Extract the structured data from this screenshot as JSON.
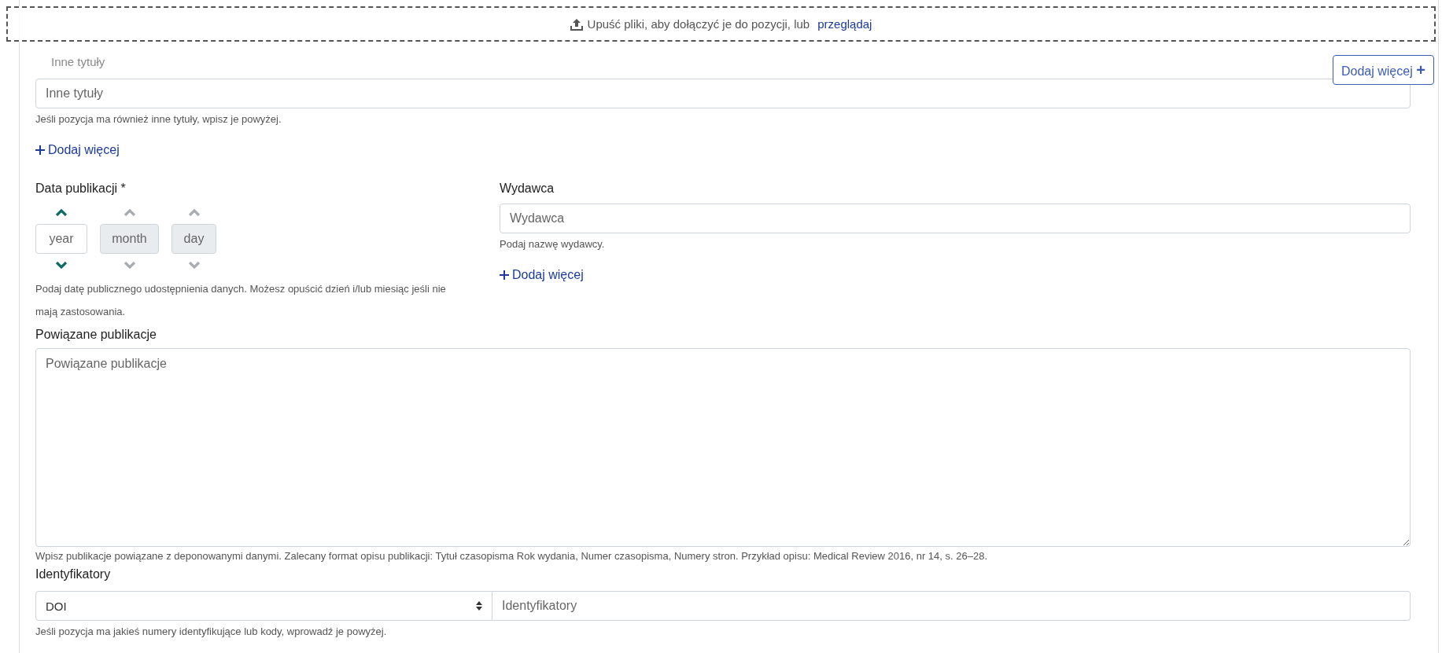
{
  "dropzone": {
    "text": "Upuść pliki, aby dołączyć je do pozycji, lub",
    "link": "przeglądaj"
  },
  "add_more_button": {
    "label": "Dodaj więcej",
    "icon": "+"
  },
  "other_titles": {
    "label": "Inne tytuły",
    "placeholder": "Inne tytuły",
    "help": "Jeśli pozycja ma również inne tytuły, wpisz je powyżej.",
    "add_link": "Dodaj więcej"
  },
  "publication_date": {
    "label": "Data publikacji *",
    "parts": [
      {
        "placeholder": "year",
        "disabled": false
      },
      {
        "placeholder": "month",
        "disabled": true
      },
      {
        "placeholder": "day",
        "disabled": true
      }
    ],
    "help": "Podaj datę publicznego udostępnienia danych. Możesz opuścić dzień i/lub miesiąc jeśli nie mają zastosowania."
  },
  "publisher": {
    "label": "Wydawca",
    "placeholder": "Wydawca",
    "help": "Podaj nazwę wydawcy.",
    "add_link": "Dodaj więcej"
  },
  "related_publications": {
    "label": "Powiązane publikacje",
    "placeholder": "Powiązane publikacje",
    "help": "Wpisz publikacje powiązane z deponowanymi danymi. Zalecany format opisu publikacji: Tytuł czasopisma Rok wydania, Numer czasopisma, Numery stron. Przykład opisu: Medical Review 2016, nr 14, s. 26–28."
  },
  "identifiers": {
    "label": "Identyfikatory",
    "type_value": "DOI",
    "placeholder": "Identyfikatory",
    "help": "Jeśli pozycja ma jakieś numery identyfikujące lub kody, wprowadź je powyżej."
  }
}
